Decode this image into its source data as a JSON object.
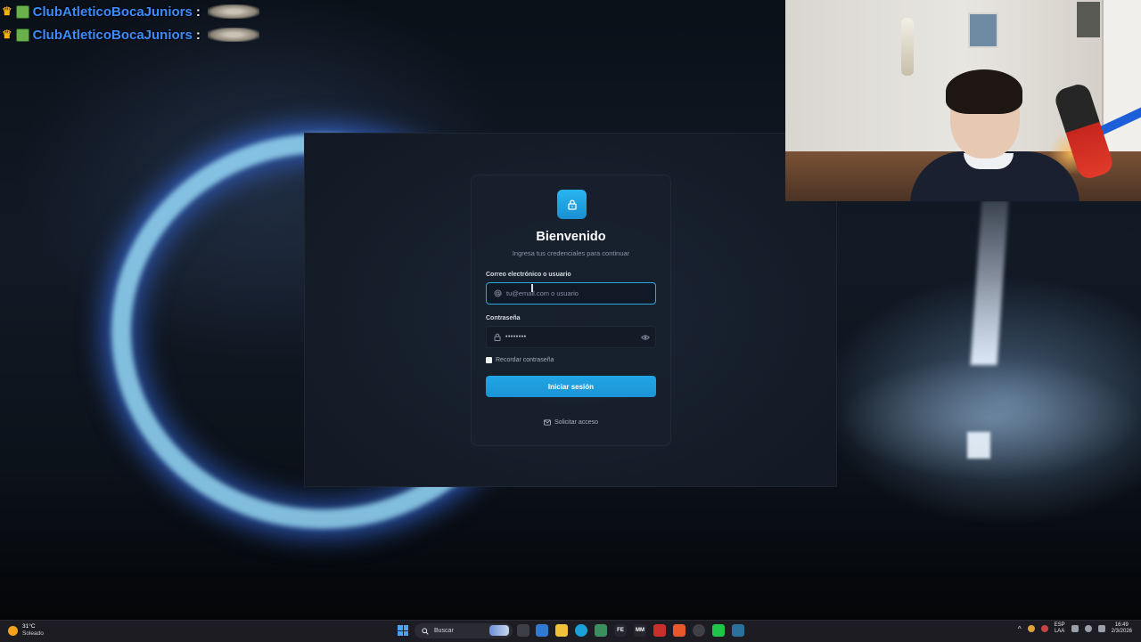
{
  "chat": {
    "lines": [
      {
        "user": "ClubAtleticoBocaJuniors",
        "sep": ":"
      },
      {
        "user": "ClubAtleticoBocaJuniors",
        "sep": ":"
      }
    ]
  },
  "login": {
    "title": "Bienvenido",
    "subtitle": "Ingresa tus credenciales para continuar",
    "email_label": "Correo electrónico o usuario",
    "email_placeholder": "tu@email.com o usuario",
    "password_label": "Contraseña",
    "password_value": "••••••••",
    "remember_label": "Recordar contraseña",
    "submit_label": "Iniciar sesión",
    "request_access_label": "Solicitar acceso"
  },
  "taskbar": {
    "weather_temp": "31°C",
    "weather_condition": "Soleado",
    "search_label": "Buscar",
    "lang_top": "ESP",
    "lang_bottom": "LAA",
    "time": "16:49",
    "date": "2/3/2026",
    "pinned_icons": [
      "file-explorer-icon",
      "folder-icon",
      "edge-icon",
      "notepad-icon",
      "fe-icon",
      "mm-icon",
      "calendar-icon",
      "brave-icon",
      "chrome-icon",
      "game-icon",
      "app-icon"
    ]
  },
  "colors": {
    "accent": "#1fa3e3",
    "chat_name": "#3a8dff",
    "card_bg": "#18202d"
  }
}
